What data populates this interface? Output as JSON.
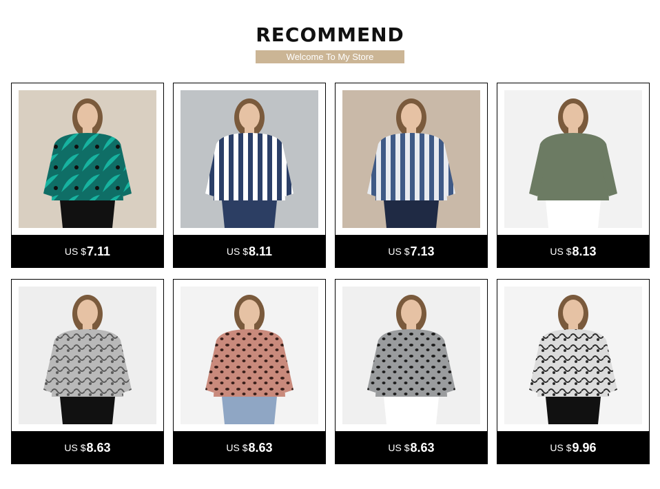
{
  "header": {
    "title": "RECOMMEND",
    "subtitle": "Welcome To My Store",
    "subtitle_bg": "#cbb595"
  },
  "currency_prefix": "US $",
  "products": [
    {
      "price": "7.11",
      "image": "woman-in-green-tropical-print-blouse",
      "pattern": "tropical",
      "colors": [
        "#0f6e66",
        "#17b3a0",
        "#101010"
      ],
      "bottom": "#111111",
      "bg": "#d9cfc1"
    },
    {
      "price": "8.11",
      "image": "woman-in-navy-white-striped-blouse",
      "pattern": "stripes",
      "colors": [
        "#2b3f67",
        "#ffffff"
      ],
      "bottom": "#2c3e63",
      "bg": "#bfc3c6"
    },
    {
      "price": "7.13",
      "image": "woman-in-blue-white-striped-shirt",
      "pattern": "stripes",
      "colors": [
        "#3f5a86",
        "#e8ebf0"
      ],
      "bottom": "#1f2a44",
      "bg": "#c9b9a8"
    },
    {
      "price": "8.13",
      "image": "woman-in-olive-green-pinstripe-blouse",
      "pattern": "solid",
      "colors": [
        "#6c7b63"
      ],
      "bottom": "#ffffff",
      "bg": "#f2f2f2"
    },
    {
      "price": "8.63",
      "image": "woman-in-grey-snakeskin-print-blouse",
      "pattern": "snake",
      "colors": [
        "#b9b9b9",
        "#5a5a5a"
      ],
      "bottom": "#111111",
      "bg": "#eeeeee"
    },
    {
      "price": "8.63",
      "image": "woman-in-pink-leopard-print-blouse",
      "pattern": "leopard",
      "colors": [
        "#c98a7c",
        "#3a1f1a"
      ],
      "bottom": "#8fa6c4",
      "bg": "#f3f3f3"
    },
    {
      "price": "8.63",
      "image": "woman-in-grey-leopard-print-blouse",
      "pattern": "leopard",
      "colors": [
        "#9a9c9e",
        "#1d1d1d"
      ],
      "bottom": "#ffffff",
      "bg": "#f0f0f0"
    },
    {
      "price": "9.96",
      "image": "woman-in-black-white-snakeskin-blouse",
      "pattern": "snake",
      "colors": [
        "#dcdcdc",
        "#2a2a2a"
      ],
      "bottom": "#111111",
      "bg": "#f4f4f4"
    }
  ]
}
